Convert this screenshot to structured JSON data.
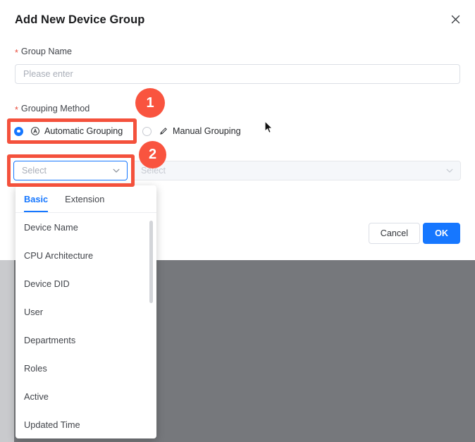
{
  "dialog": {
    "title": "Add New Device Group",
    "close_icon": "close-icon",
    "fields": {
      "group_name": {
        "label": "Group Name",
        "required_marker": "*",
        "value": "",
        "placeholder": "Please enter"
      },
      "grouping_method": {
        "label": "Grouping Method",
        "required_marker": "*",
        "options": [
          {
            "label": "Automatic Grouping",
            "icon": "automatic-grouping-icon",
            "selected": true
          },
          {
            "label": "Manual Grouping",
            "icon": "pencil-icon",
            "selected": false
          }
        ]
      },
      "primary_select": {
        "placeholder": "Select",
        "value": "",
        "icon": "chevron-down-icon",
        "state": "focused-open"
      },
      "secondary_select": {
        "placeholder": "Select",
        "value": "",
        "icon": "chevron-down-icon",
        "state": "disabled"
      }
    },
    "footer": {
      "cancel_label": "Cancel",
      "ok_label": "OK"
    }
  },
  "dropdown": {
    "tabs": [
      {
        "label": "Basic",
        "active": true
      },
      {
        "label": "Extension",
        "active": false
      }
    ],
    "options": [
      {
        "label": "Device Name"
      },
      {
        "label": "CPU Architecture"
      },
      {
        "label": "Device DID"
      },
      {
        "label": "User"
      },
      {
        "label": "Departments"
      },
      {
        "label": "Roles"
      },
      {
        "label": "Active"
      },
      {
        "label": "Updated Time"
      }
    ]
  },
  "annotations": {
    "badges": [
      {
        "label": "1"
      },
      {
        "label": "2"
      }
    ],
    "highlight_color": "#f4513c",
    "badge_color": "#f9543f"
  },
  "colors": {
    "accent": "#1677ff",
    "required": "#e8493a",
    "backdrop": "#76787c",
    "dialog_bg": "#ffffff"
  }
}
